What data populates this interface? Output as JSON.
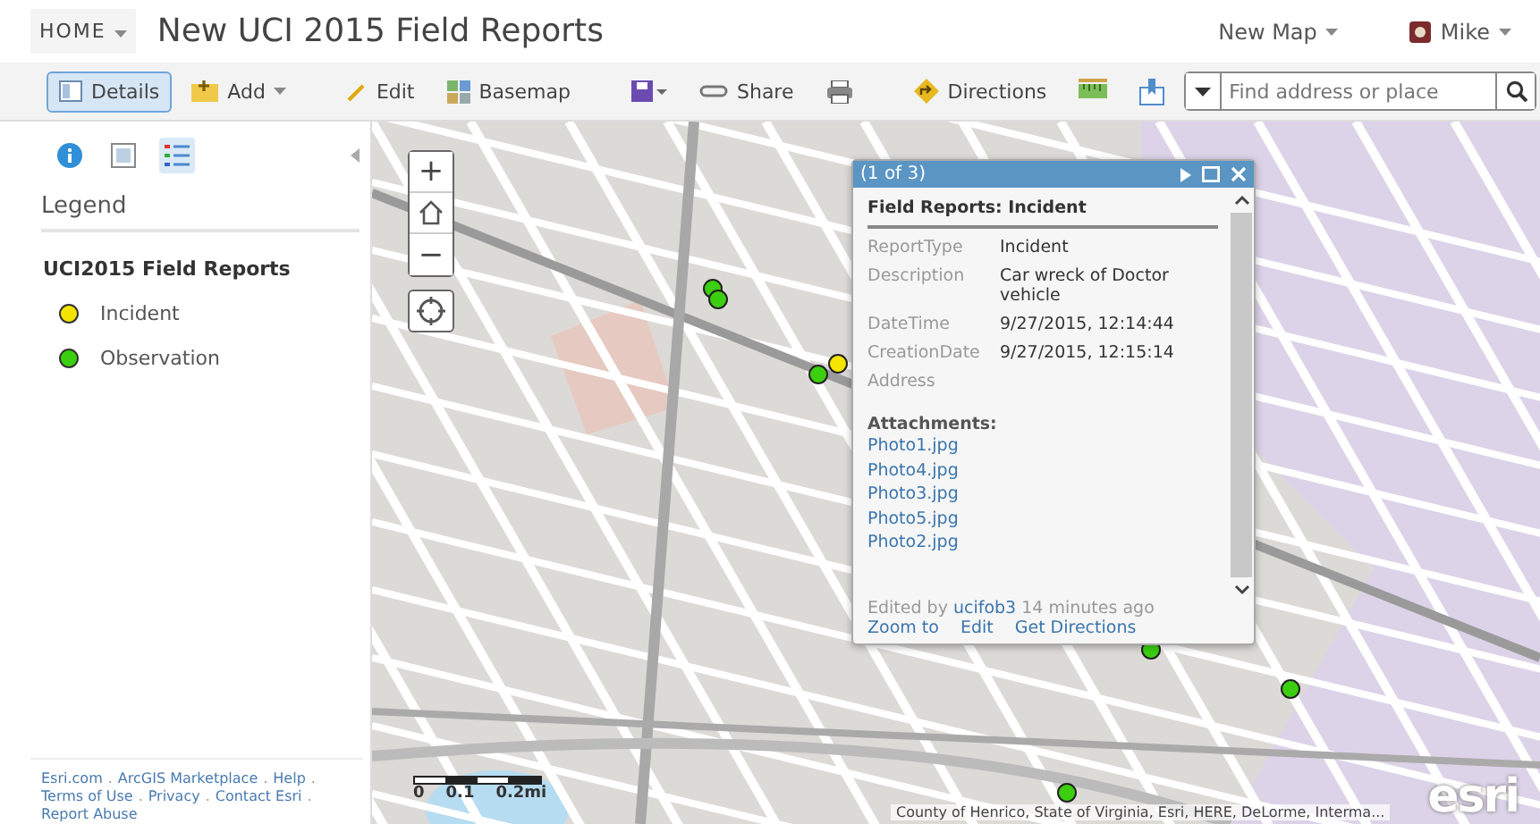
{
  "header": {
    "home_menu": "HOME",
    "title": "New UCI 2015 Field Reports",
    "new_map_menu": "New Map",
    "user_menu": "Mike"
  },
  "toolbar": {
    "buttons": [
      {
        "kind": "details",
        "label": "Details",
        "selected": true
      },
      {
        "kind": "add",
        "label": "Add",
        "selected": false
      },
      {
        "kind": "edit",
        "label": "Edit",
        "selected": false
      },
      {
        "kind": "basemap",
        "label": "Basemap",
        "selected": false
      },
      {
        "kind": "save",
        "selected": false
      },
      {
        "kind": "share",
        "label": "Share",
        "selected": false
      },
      {
        "kind": "print",
        "selected": false
      },
      {
        "kind": "directions",
        "label": "Directions",
        "selected": false
      },
      {
        "kind": "measure",
        "selected": false
      },
      {
        "kind": "bookmarks",
        "selected": false
      }
    ],
    "search": {
      "placeholder": "Find address or place"
    }
  },
  "sidebar": {
    "tabs": [
      {
        "kind": "about",
        "selected": false
      },
      {
        "kind": "content",
        "selected": false
      },
      {
        "kind": "legend",
        "selected": true
      }
    ],
    "heading": "Legend",
    "layer": "UCI2015 Field Reports",
    "legend_items": [
      {
        "label": "Incident",
        "color": "#f5e400"
      },
      {
        "label": "Observation",
        "color": "#3ccf10"
      }
    ],
    "footer_separator": ".",
    "footer_links": [
      "Esri.com",
      "ArcGIS Marketplace",
      "Help",
      "Terms of Use",
      "Privacy",
      "Contact Esri",
      "Report Abuse"
    ]
  },
  "map": {
    "zoom_in": "+",
    "zoom_out": "−",
    "markers": [
      {
        "kind": "observation"
      },
      {
        "kind": "observation"
      },
      {
        "kind": "observation"
      },
      {
        "kind": "incident"
      },
      {
        "kind": "observation"
      },
      {
        "kind": "observation"
      },
      {
        "kind": "observation"
      }
    ],
    "scale_labels": [
      "0",
      "0.1",
      "0.2mi"
    ],
    "attribution": "County of Henrico, State of Virginia, Esri, HERE, DeLorme, Interma...",
    "logo": "esri",
    "popup": {
      "counter": "(1 of 3)",
      "title": "Field Reports: Incident",
      "fields": [
        {
          "label": "ReportType",
          "value": "Incident"
        },
        {
          "label": "Description",
          "value": "Car wreck of Doctor vehicle"
        },
        {
          "label": "DateTime",
          "value": "9/27/2015, 12:14:44"
        },
        {
          "label": "CreationDate",
          "value": "9/27/2015, 12:15:14"
        },
        {
          "label": "Address"
        }
      ],
      "attachments_label": "Attachments:",
      "attachments": [
        "Photo1.jpg",
        "Photo4.jpg",
        "Photo3.jpg",
        "Photo5.jpg",
        "Photo2.jpg"
      ],
      "edited_prefix": "Edited by",
      "edited_user": "ucifob3",
      "edited_suffix": "14 minutes ago",
      "actions": [
        "Zoom to",
        "Edit",
        "Get Directions"
      ]
    }
  }
}
